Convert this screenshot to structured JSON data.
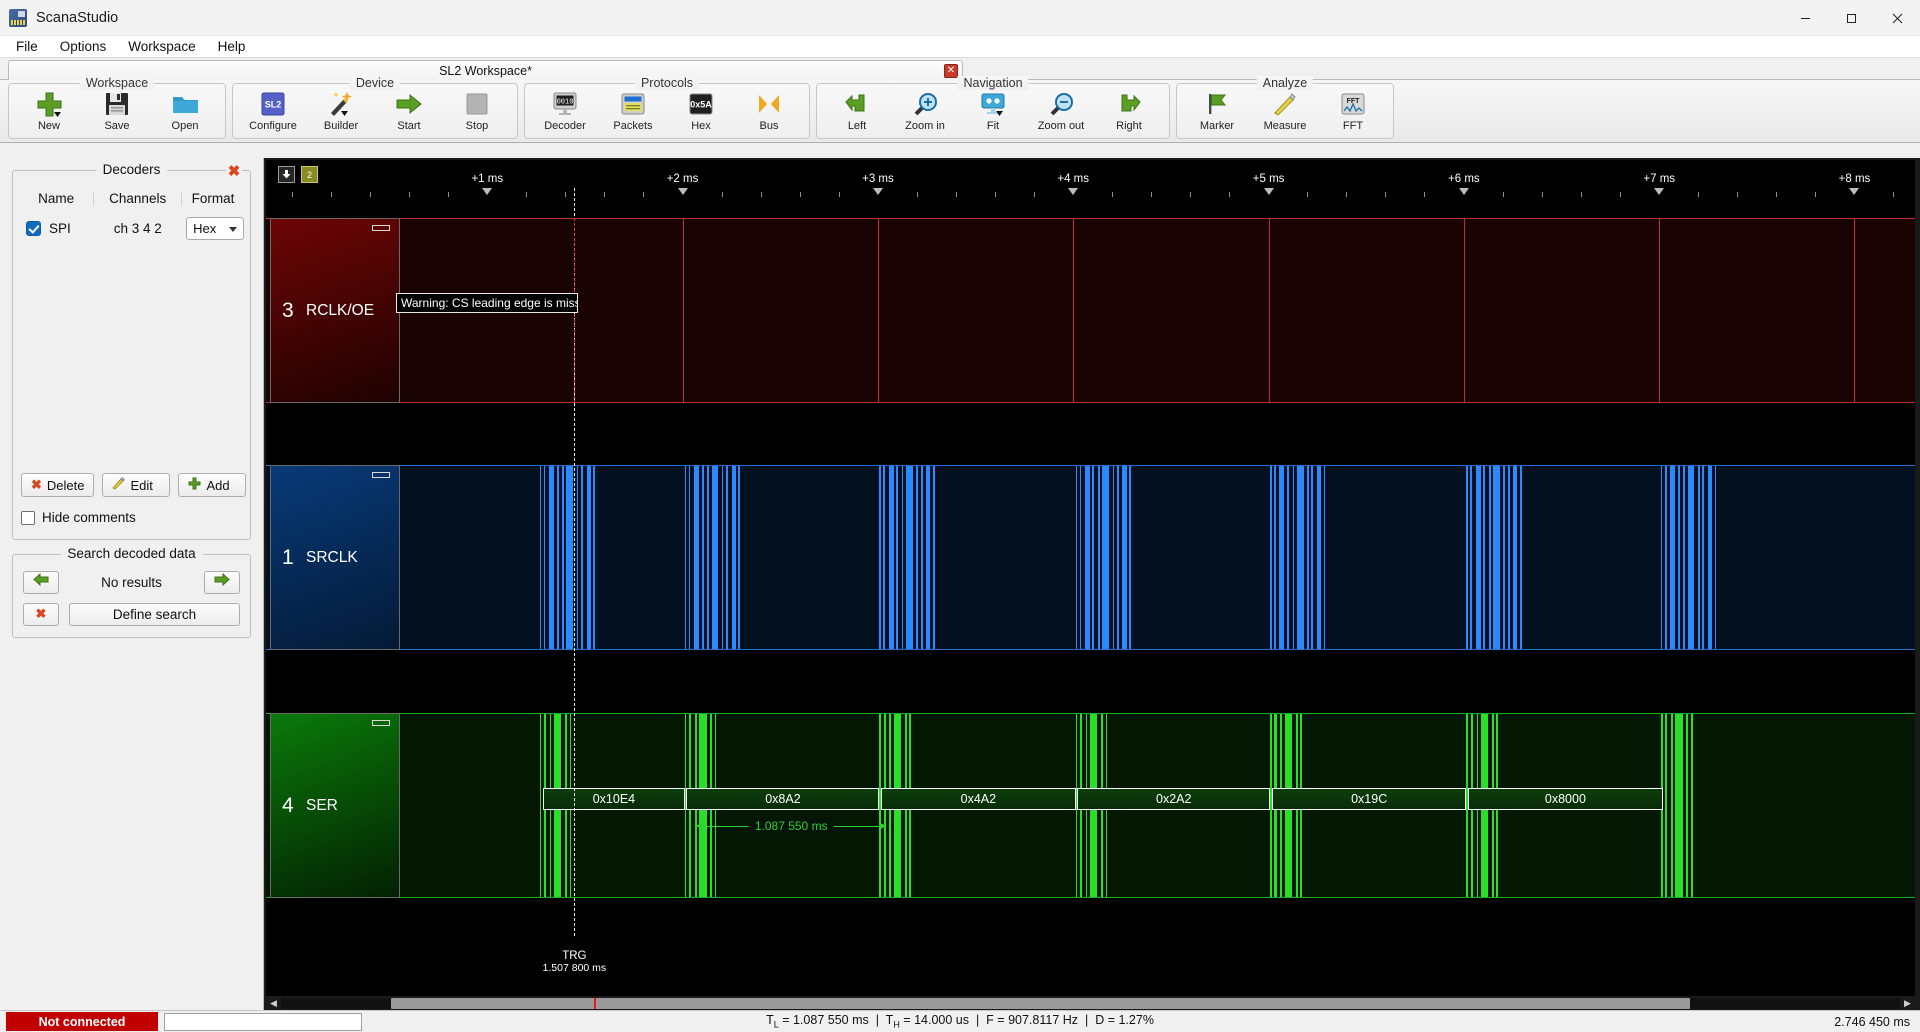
{
  "window": {
    "title": "ScanaStudio",
    "app_icon": "scanastudio-logo-icon",
    "minimize": "–",
    "maximize": "☐",
    "close": "✕"
  },
  "menubar": {
    "items": [
      "File",
      "Options",
      "Workspace",
      "Help"
    ]
  },
  "workspace_tab": {
    "label": "SL2 Workspace*",
    "close_label": "✕"
  },
  "ribbon": {
    "groups": [
      {
        "title": "Workspace",
        "buttons": [
          {
            "label": "New",
            "icon": "plus-green-icon",
            "dropdown": true
          },
          {
            "label": "Save",
            "icon": "floppy-disk-icon",
            "dropdown": false
          },
          {
            "label": "Open",
            "icon": "folder-open-icon",
            "dropdown": false
          }
        ]
      },
      {
        "title": "Device",
        "buttons": [
          {
            "label": "Configure",
            "icon": "sl2-device-icon",
            "dropdown": false
          },
          {
            "label": "Builder",
            "icon": "magic-wand-icon",
            "dropdown": true
          },
          {
            "label": "Start",
            "icon": "arrow-right-green-icon",
            "dropdown": false
          },
          {
            "label": "Stop",
            "icon": "stop-square-icon",
            "dropdown": false
          }
        ]
      },
      {
        "title": "Protocols",
        "buttons": [
          {
            "label": "Decoder",
            "icon": "binary-monitor-icon",
            "dropdown": false
          },
          {
            "label": "Packets",
            "icon": "packets-list-icon",
            "dropdown": false
          },
          {
            "label": "Hex",
            "icon": "hex-0x5a-icon",
            "dropdown": false
          },
          {
            "label": "Bus",
            "icon": "bus-hourglass-icon",
            "dropdown": false
          }
        ]
      },
      {
        "title": "Navigation",
        "buttons": [
          {
            "label": "Left",
            "icon": "arrow-left-step-icon",
            "dropdown": false
          },
          {
            "label": "Zoom in",
            "icon": "magnifier-plus-icon",
            "dropdown": false
          },
          {
            "label": "Fit",
            "icon": "fit-screen-icon",
            "dropdown": true
          },
          {
            "label": "Zoom out",
            "icon": "magnifier-minus-icon",
            "dropdown": false
          },
          {
            "label": "Right",
            "icon": "arrow-right-step-icon",
            "dropdown": false
          }
        ]
      },
      {
        "title": "Analyze",
        "buttons": [
          {
            "label": "Marker",
            "icon": "flag-green-icon",
            "dropdown": false
          },
          {
            "label": "Measure",
            "icon": "ruler-pencil-icon",
            "dropdown": false
          },
          {
            "label": "FFT",
            "icon": "fft-icon",
            "dropdown": false
          }
        ]
      }
    ]
  },
  "decoders_panel": {
    "title": "Decoders",
    "close_label": "✖",
    "columns": [
      "Name",
      "Channels",
      "Format"
    ],
    "rows": [
      {
        "checked": true,
        "name": "SPI",
        "channels": "ch 3 4 2",
        "format": "Hex"
      }
    ],
    "buttons": [
      {
        "label": "Delete",
        "icon": "x-red-icon"
      },
      {
        "label": "Edit",
        "icon": "pencil-icon"
      },
      {
        "label": "Add",
        "icon": "plus-green-icon"
      }
    ],
    "hide_comments": {
      "label": "Hide comments",
      "checked": false
    }
  },
  "search_panel": {
    "title": "Search decoded data",
    "prev_icon": "arrow-left-green-icon",
    "next_icon": "arrow-right-green-icon",
    "result_text": "No results",
    "clear_icon": "x-red-icon",
    "define_label": "Define search"
  },
  "waveform": {
    "top_buttons": [
      {
        "icon": "download-arrow-icon",
        "label": ""
      },
      {
        "icon": "channel-count-badge",
        "label": "2"
      }
    ],
    "time_ticks": [
      {
        "label": "+1 ms",
        "x_pct": 13.42
      },
      {
        "label": "+2 ms",
        "x_pct": 25.26
      },
      {
        "label": "+3 ms",
        "x_pct": 37.11
      },
      {
        "label": "+4 ms",
        "x_pct": 48.95
      },
      {
        "label": "+5 ms",
        "x_pct": 60.8
      },
      {
        "label": "+6 ms",
        "x_pct": 72.64
      },
      {
        "label": "+7 ms",
        "x_pct": 84.49
      },
      {
        "label": "+8 ms",
        "x_pct": 96.33
      }
    ],
    "channels": [
      {
        "number": "3",
        "name": "RCLK/OE",
        "color": "#8b0000",
        "gradient_from": "#6e0505",
        "gradient_to": "#1e0202",
        "bg": "#190303",
        "line_color": "#c23131",
        "warning": "Warning: CS leading edge is missing!",
        "edges_pct": [
          25.26,
          37.11,
          48.95,
          60.8,
          72.64,
          84.49,
          96.33
        ]
      },
      {
        "number": "1",
        "name": "SRCLK",
        "color": "#1f6fd0",
        "gradient_from": "#083a78",
        "gradient_to": "#041a36",
        "bg": "#03101f",
        "line_color": "#1f6fd0",
        "pulse_color": "#2b8aff",
        "bursts_pct": [
          16.6,
          25.4,
          37.2,
          49.1,
          60.9,
          72.8,
          84.6
        ]
      },
      {
        "number": "4",
        "name": "SER",
        "color": "#12a012",
        "gradient_from": "#0a7a0a",
        "gradient_to": "#032003",
        "bg": "#031703",
        "line_color": "#18b018",
        "pulse_color": "#27e027",
        "bursts_pct": [
          16.6,
          25.4,
          37.2,
          49.1,
          60.9,
          72.8,
          84.6
        ],
        "packets": [
          {
            "label": "0x10E4",
            "start_pct": 16.8,
            "end_pct": 25.4
          },
          {
            "label": "0x8A2",
            "start_pct": 25.5,
            "end_pct": 37.2
          },
          {
            "label": "0x4A2",
            "start_pct": 37.3,
            "end_pct": 49.1
          },
          {
            "label": "0x2A2",
            "start_pct": 49.2,
            "end_pct": 60.9
          },
          {
            "label": "0x19C",
            "start_pct": 61.0,
            "end_pct": 72.8
          },
          {
            "label": "0x8000",
            "start_pct": 72.9,
            "end_pct": 84.7
          }
        ],
        "measurement": {
          "label": "1.087 550 ms",
          "start_pct": 26.1,
          "end_pct": 37.6
        }
      }
    ],
    "trigger": {
      "label": "TRG",
      "time": "1.507 800 ms",
      "x_pct": 18.7
    },
    "scrollbar": {
      "thumb_start_pct": 6.8,
      "thumb_end_pct": 87.0,
      "left_arrow": "◀",
      "right_arrow": "▶"
    }
  },
  "statusbar": {
    "connection": "Not connected",
    "input_value": "",
    "measurements": {
      "tl_label": "T",
      "tl_sub": "L",
      "tl_value": "1.087 550 ms",
      "th_label": "T",
      "th_sub": "H",
      "th_value": "14.000 us",
      "f_label": "F",
      "f_value": "907.8117 Hz",
      "d_label": "D",
      "d_value": "1.27%",
      "full": "T_L = 1.087 550 ms  |  T_H = 14.000 us  |  F = 907.8117 Hz  |  D = 1.27%"
    },
    "total_time": "2.746 450 ms"
  },
  "colors": {
    "accent_blue": "#0f6cbd",
    "status_red": "#c00000",
    "channel_red": "#8b0000",
    "channel_blue": "#1f6fd0",
    "channel_green": "#12a012"
  }
}
